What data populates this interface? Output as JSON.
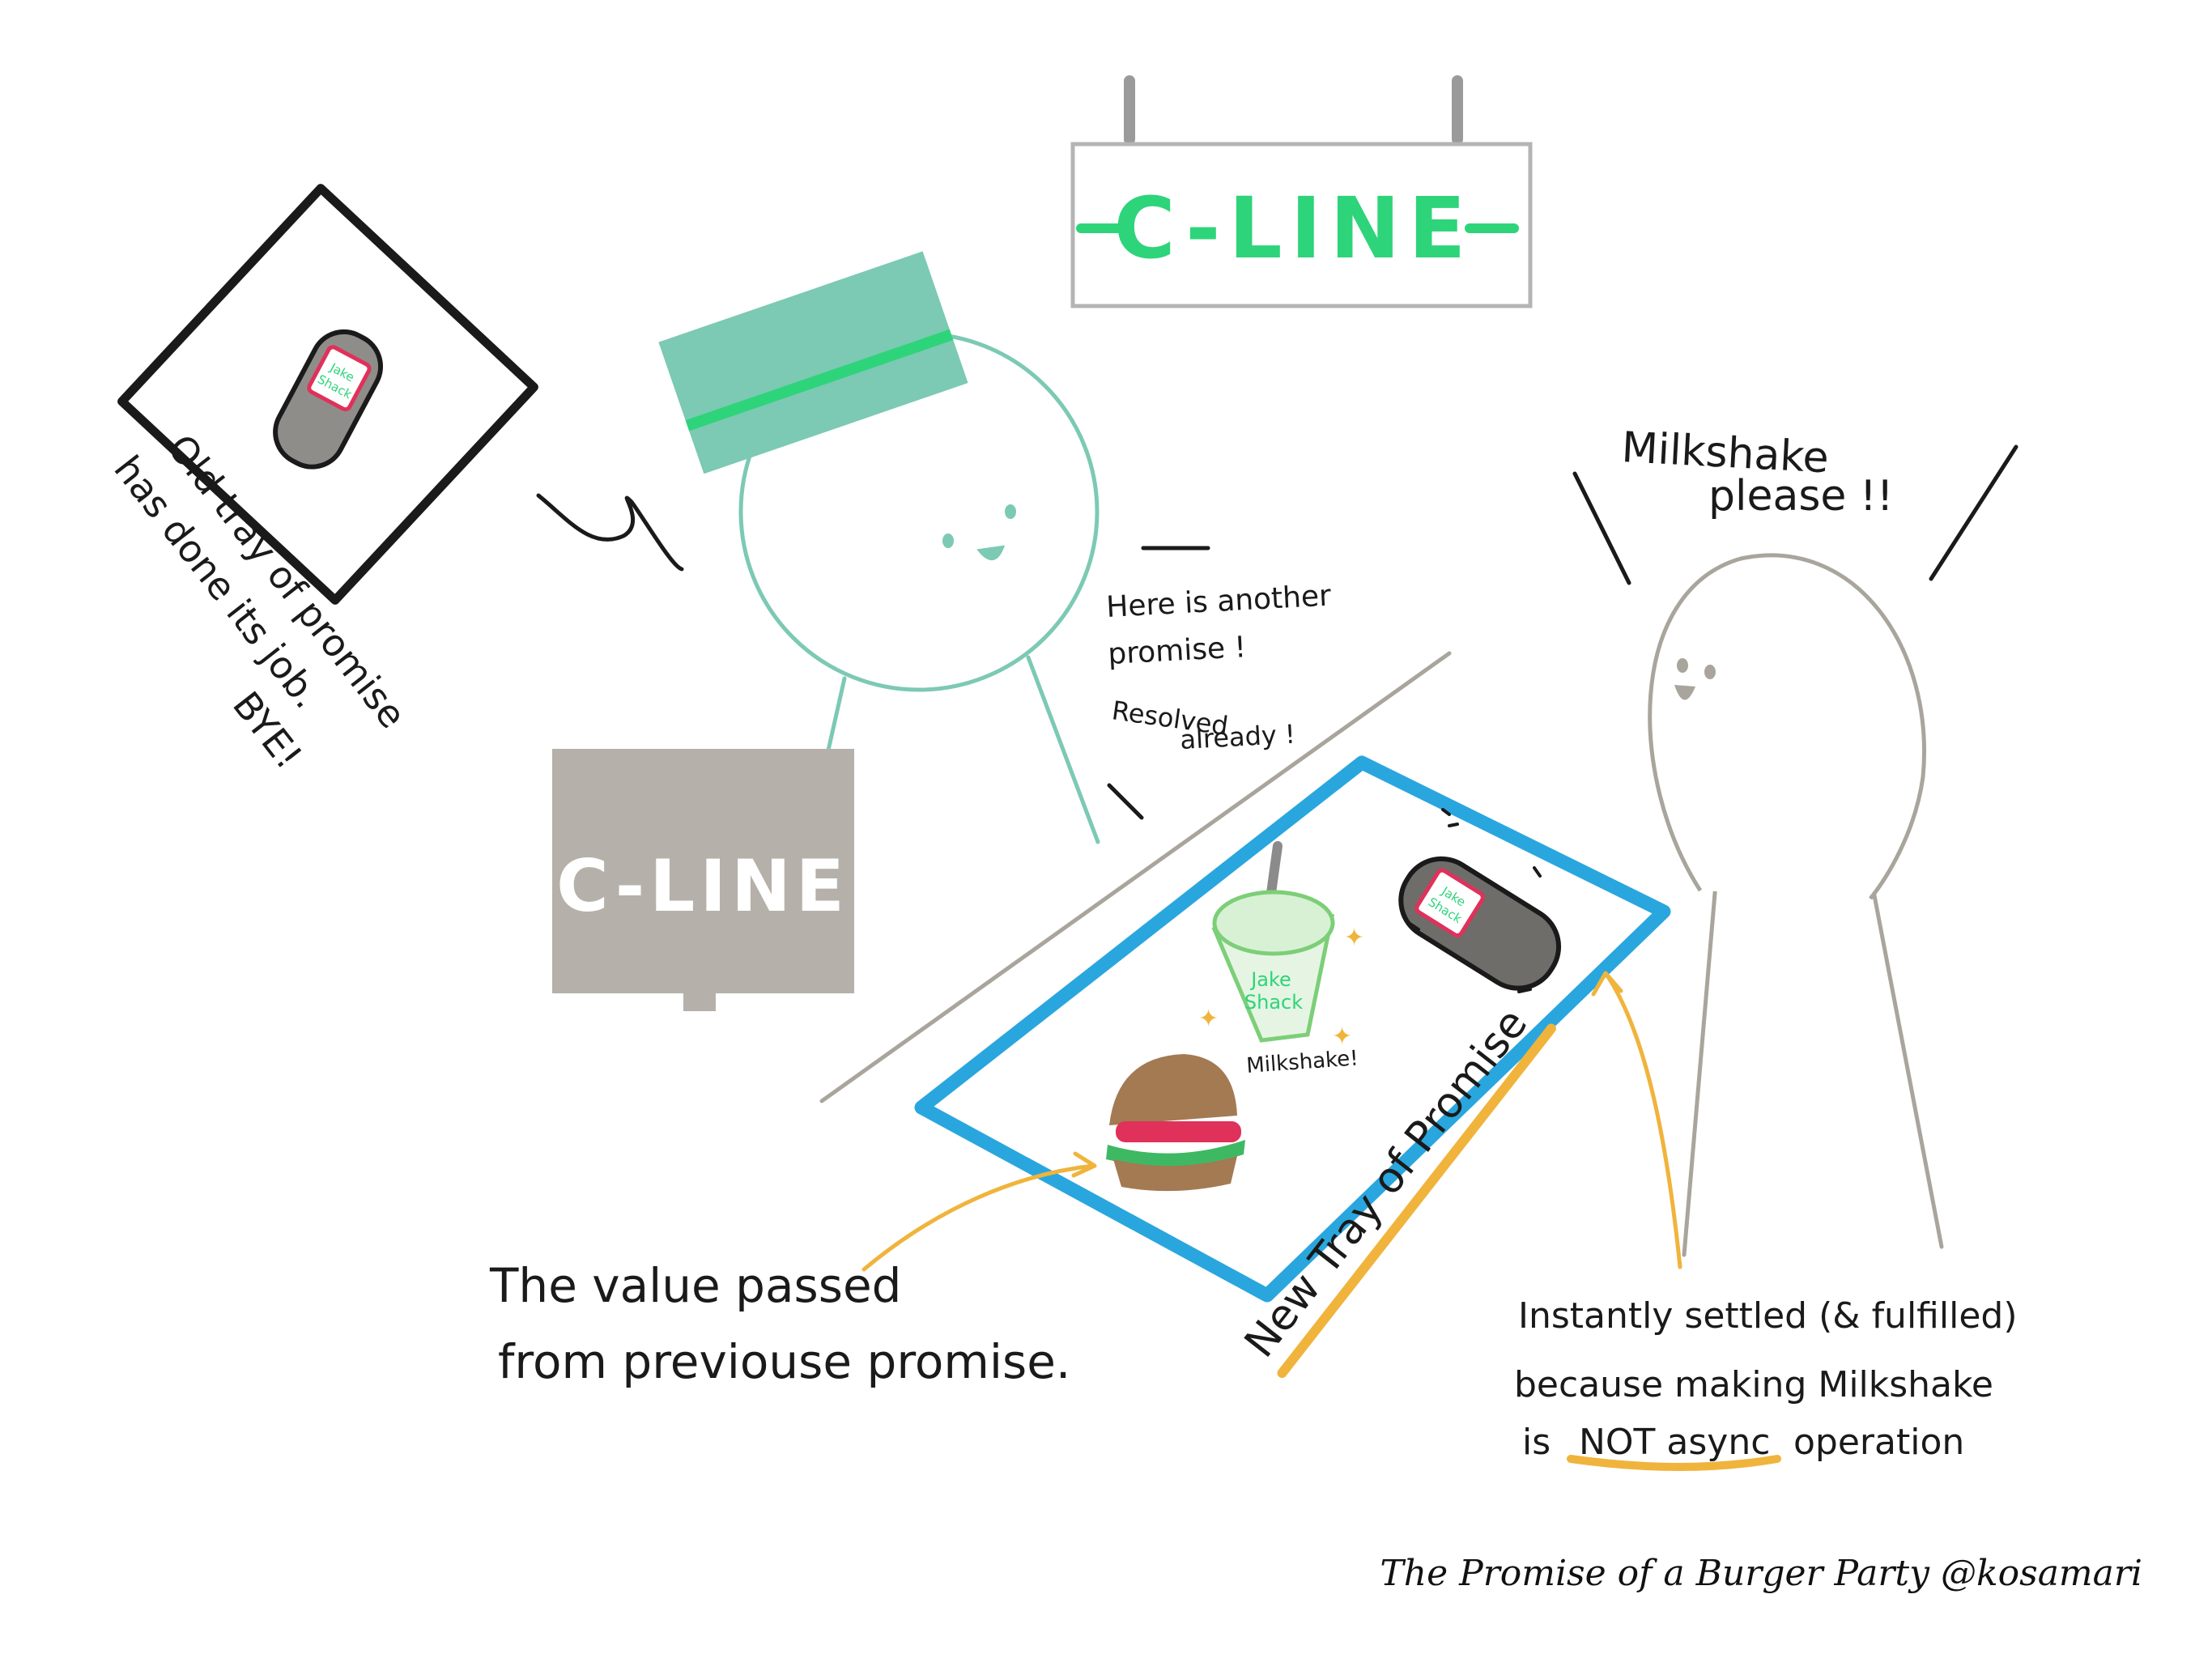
{
  "colors": {
    "teal": "#7cc9b4",
    "green": "#2ed47a",
    "gray": "#a9a59d",
    "blue": "#2aa6de",
    "orange": "#f0b43c",
    "ink": "#1a1a1a"
  },
  "signs": {
    "hanging": "C-LINE",
    "register": "C-LINE"
  },
  "brand": {
    "line1": "Jake",
    "line2": "Shack"
  },
  "old_tray_note": {
    "line1": "Old tray of promise",
    "line2": "has done its job.",
    "line3": "BYE!"
  },
  "staff_speech": {
    "line1": "Here is another",
    "line2": "promise !",
    "line3": "Resolved",
    "line4": "already !"
  },
  "customer_speech": {
    "line1": "Milkshake",
    "line2": "please !!"
  },
  "milkshake_label": "Milkshake!",
  "tray_label": "New Tray of Promise",
  "value_note": {
    "line1": "The value passed",
    "line2": "from previouse promise."
  },
  "settled_note": {
    "line1": "Instantly settled (& fulfilled)",
    "line2": "because making Milkshake",
    "line3_prefix": "is",
    "line3_highlight": "NOT async",
    "line3_suffix": "operation"
  },
  "caption": "The Promise of a Burger Party @kosamari"
}
